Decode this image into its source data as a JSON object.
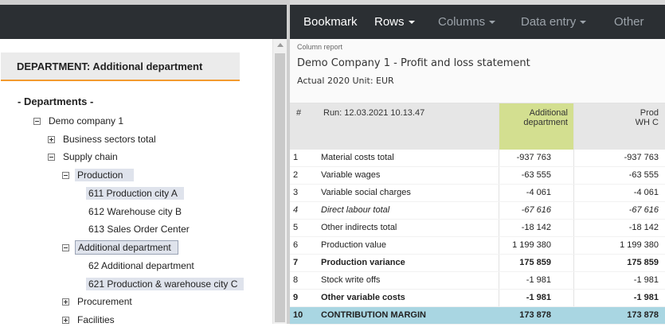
{
  "left_panel": {
    "department_title": "DEPARTMENT: Additional department",
    "tree_root": "- Departments -",
    "nodes": [
      {
        "label": "Demo company 1",
        "toggle": "minus"
      },
      {
        "label": "Business sectors total",
        "toggle": "plus"
      },
      {
        "label": "Supply chain",
        "toggle": "minus"
      },
      {
        "label": "Production",
        "toggle": "minus"
      },
      {
        "label": "611 Production city A",
        "toggle": "none"
      },
      {
        "label": "612 Warehouse city B",
        "toggle": "none"
      },
      {
        "label": "613 Sales Order Center",
        "toggle": "none"
      },
      {
        "label": "Additional department",
        "toggle": "minus"
      },
      {
        "label": "62 Additional department",
        "toggle": "none"
      },
      {
        "label": "621 Production & warehouse city C",
        "toggle": "none"
      },
      {
        "label": "Procurement",
        "toggle": "plus"
      },
      {
        "label": "Facilities",
        "toggle": "plus"
      }
    ]
  },
  "top_nav": {
    "items": [
      {
        "label": "Bookmark",
        "has_caret": false
      },
      {
        "label": "Rows",
        "has_caret": true
      },
      {
        "label": "Columns",
        "has_caret": true
      },
      {
        "label": "Data entry",
        "has_caret": true
      },
      {
        "label": "Other",
        "has_caret": false
      }
    ],
    "active": "Rows"
  },
  "report": {
    "column_report_label": "Column report",
    "title": "Demo Company 1 - Profit and loss statement",
    "subtitle": "Actual 2020 Unit: EUR"
  },
  "table": {
    "hash_header": "#",
    "run_header": "Run: 12.03.2021 10.13.47",
    "col1_header_line1": "Additional",
    "col1_header_line2": "department",
    "col2_header_line1": "Prod",
    "col2_header_line2": "WH C",
    "rows": [
      {
        "num": "1",
        "label": "Material costs total",
        "v1": "-937 763",
        "v2": "-937 763",
        "style": "normal"
      },
      {
        "num": "2",
        "label": "Variable wages",
        "v1": "-63 555",
        "v2": "-63 555",
        "style": "normal"
      },
      {
        "num": "3",
        "label": "Variable social charges",
        "v1": "-4 061",
        "v2": "-4 061",
        "style": "normal"
      },
      {
        "num": "4",
        "label": "Direct labour total",
        "v1": "-67 616",
        "v2": "-67 616",
        "style": "italic"
      },
      {
        "num": "5",
        "label": "Other indirects total",
        "v1": "-18 142",
        "v2": "-18 142",
        "style": "normal"
      },
      {
        "num": "6",
        "label": "Production value",
        "v1": "1 199 380",
        "v2": "1 199 380",
        "style": "normal"
      },
      {
        "num": "7",
        "label": "Production variance",
        "v1": "175 859",
        "v2": "175 859",
        "style": "bold"
      },
      {
        "num": "8",
        "label": "Stock write offs",
        "v1": "-1 981",
        "v2": "-1 981",
        "style": "normal"
      },
      {
        "num": "9",
        "label": "Other variable costs",
        "v1": "-1 981",
        "v2": "-1 981",
        "style": "bold"
      },
      {
        "num": "10",
        "label": "CONTRIBUTION MARGIN",
        "v1": "173 878",
        "v2": "173 878",
        "style": "total"
      }
    ]
  },
  "colors": {
    "nav_bg": "#2b2f33",
    "accent_orange": "#f29a2e",
    "column_highlight": "#d3df90",
    "total_row": "#a9d6e2",
    "tree_highlight": "#dfe3ec"
  }
}
